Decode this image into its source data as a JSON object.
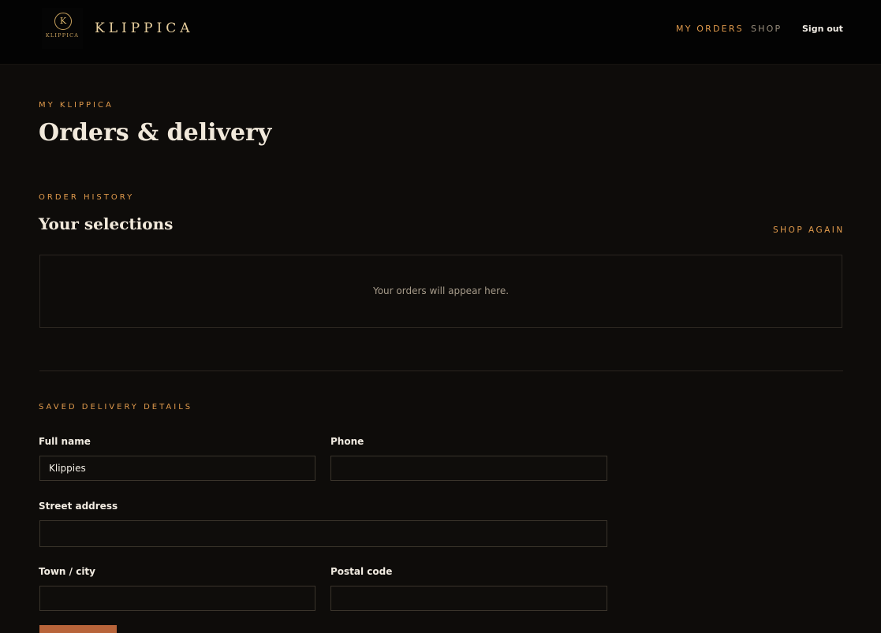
{
  "header": {
    "logo_letter": "K",
    "logo_wordmark": "KLIPPICA",
    "brand_name": "KLIPPICA",
    "nav": {
      "my_orders": "MY ORDERS",
      "shop": "SHOP",
      "sign_out": "Sign out"
    }
  },
  "page": {
    "eyebrow": "MY KLIPPICA",
    "title": "Orders & delivery"
  },
  "order_history": {
    "eyebrow": "ORDER HISTORY",
    "title": "Your selections",
    "shop_again": "SHOP AGAIN",
    "empty_message": "Your orders will appear here."
  },
  "delivery": {
    "eyebrow": "SAVED DELIVERY DETAILS",
    "full_name": {
      "label": "Full name",
      "value": "Klippies"
    },
    "phone": {
      "label": "Phone",
      "value": ""
    },
    "street": {
      "label": "Street address",
      "value": ""
    },
    "town": {
      "label": "Town / city",
      "value": ""
    },
    "postal": {
      "label": "Postal code",
      "value": ""
    }
  },
  "colors": {
    "background": "#0e0c0a",
    "header": "#030303",
    "accent": "#e09a4c",
    "gold": "#c9a25e",
    "button": "#b8643a"
  }
}
